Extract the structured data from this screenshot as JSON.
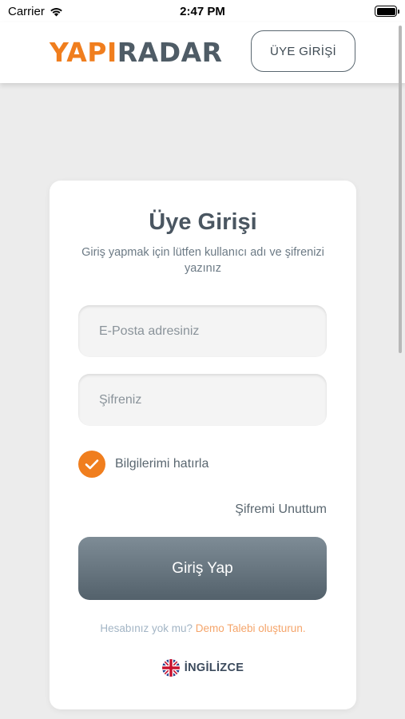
{
  "status_bar": {
    "carrier": "Carrier",
    "time": "2:47 PM"
  },
  "header": {
    "logo_part1": "YAPI",
    "logo_part2": "RADAR",
    "login_button": "ÜYE GİRİŞİ",
    "colors": {
      "brand_orange": "#f07e1e",
      "brand_gray": "#4f5c66"
    }
  },
  "card": {
    "title": "Üye Girişi",
    "subtitle": "Giriş yapmak için lütfen kullanıcı adı ve şifrenizi yazınız",
    "email": {
      "placeholder": "E-Posta adresiniz",
      "value": ""
    },
    "password": {
      "placeholder": "Şifreniz",
      "value": ""
    },
    "remember": {
      "label": "Bilgilerimi hatırla",
      "checked": true
    },
    "forgot": "Şifremi Unuttum",
    "login_button": "Giriş Yap",
    "signup": {
      "question": "Hesabınız yok mu?",
      "link": "Demo Talebi oluşturun."
    },
    "language": {
      "label": "İNGİLİZCE",
      "icon": "uk-flag-icon"
    }
  }
}
